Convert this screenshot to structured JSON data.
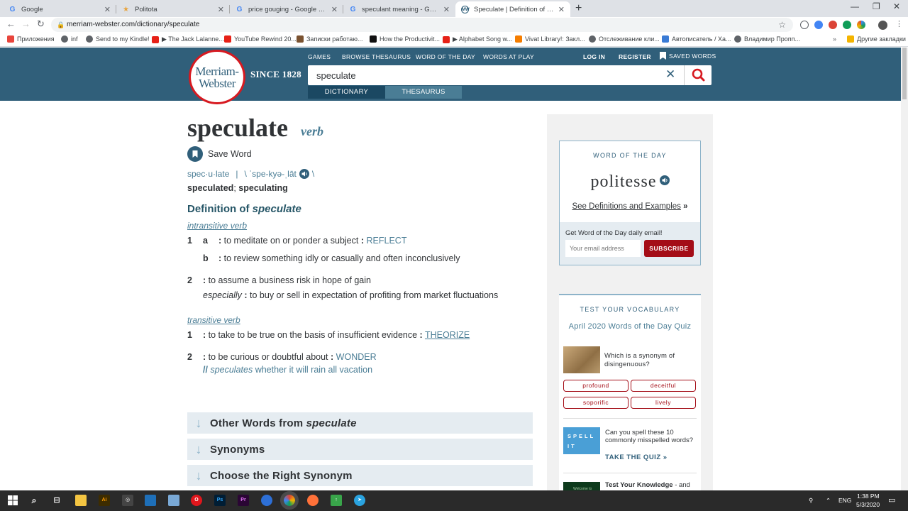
{
  "browser": {
    "tabs": [
      {
        "title": "Google",
        "favicon": "G",
        "color": "#4285f4"
      },
      {
        "title": "Politota",
        "favicon": "★",
        "color": "#e8a33c"
      },
      {
        "title": "price gouging - Google Search",
        "favicon": "G",
        "color": "#4285f4"
      },
      {
        "title": "speculant meaning - Google Sea",
        "favicon": "G",
        "color": "#4285f4"
      },
      {
        "title": "Speculate | Definition of Specula",
        "favicon": "MW",
        "color": "#305f7a"
      }
    ],
    "url": "merriam-webster.com/dictionary/speculate",
    "bookmarks": [
      "Приложения",
      "inf",
      "Send to my Kindle!",
      "▶ The Jack Lalanne...",
      "YouTube Rewind 20...",
      "Записки работаю...",
      "How the Productivit...",
      "▶ Alphabet Song w...",
      "Vivat Library!: Закл...",
      "Отслеживание кли...",
      "Автописатель / Ха...",
      "Владимир Пропп...",
      "Другие закладки"
    ]
  },
  "header": {
    "logo_line1": "Merriam-",
    "logo_line2": "Webster",
    "since": "SINCE 1828",
    "nav": [
      "GAMES",
      "BROWSE THESAURUS",
      "WORD OF THE DAY",
      "WORDS AT PLAY"
    ],
    "login": "LOG IN",
    "register": "REGISTER",
    "saved": "SAVED WORDS",
    "search_value": "speculate",
    "tab_dictionary": "DICTIONARY",
    "tab_thesaurus": "THESAURUS",
    "colors": {
      "header": "#305f7a",
      "tab_active": "#1b4862",
      "tab_inactive": "#4a7d95",
      "accent_red": "#d71920"
    }
  },
  "entry": {
    "headword": "speculate",
    "pos": "verb",
    "save_word": "Save Word",
    "syllables": "spec·u·late",
    "sep": "|",
    "pron_open": "\\ ˈspe-kyə-ˌlāt",
    "pron_close": "\\",
    "form1": "speculated",
    "form_sep": ";",
    "form2": "speculating",
    "def_prefix": "Definition of",
    "def_word": "speculate",
    "intransitive_label": "intransitive verb",
    "transitive_label": "transitive verb",
    "senses": {
      "i1": "1",
      "i1a_letter": "a",
      "i1a_text": "to meditate on or ponder a subject",
      "i1a_link": "REFLECT",
      "i1b_letter": "b",
      "i1b_text": "to review something idly or casually and often inconclusively",
      "i2": "2",
      "i2_text": "to assume a business risk in hope of gain",
      "i2_especially": "especially",
      "i2_sub": "to buy or sell in expectation of profiting from market fluctuations",
      "t1": "1",
      "t1_text": "to take to be true on the basis of insufficient evidence",
      "t1_link": "THEORIZE",
      "t2": "2",
      "t2_text": "to be curious or doubtful about",
      "t2_link": "WONDER",
      "t2_ex_mark": "//",
      "t2_ex_word": "speculates",
      "t2_ex_rest": "whether it will rain all vacation"
    },
    "colon": ":",
    "accordions": [
      {
        "prefix": "Other Words from",
        "italic": "speculate"
      },
      {
        "prefix": "Synonyms",
        "italic": ""
      },
      {
        "prefix": "Choose the Right Synonym",
        "italic": ""
      }
    ]
  },
  "sidebar": {
    "wotd_label": "WORD OF THE DAY",
    "wotd_word": "politesse",
    "wotd_see": "See Definitions and Examples",
    "wotd_chevron": "»",
    "wotd_get": "Get Word of the Day daily email!",
    "wotd_email_placeholder": "Your email address",
    "wotd_subscribe": "SUBSCRIBE",
    "vocab_label": "TEST YOUR VOCABULARY",
    "vocab_quiz": "April 2020 Words of the Day Quiz",
    "vocab_q_prefix": "Which is a synonym of",
    "vocab_q_word": "disingenuous?",
    "options": [
      "profound",
      "deceitful",
      "soporific",
      "lively"
    ],
    "spell_text": "Can you spell these 10 commonly misspelled words?",
    "spell_tile": "SPELL IT",
    "take_quiz": "TAKE THE QUIZ »",
    "tk_bold": "Test Your Knowledge",
    "tk_rest": "- and learn some interesting",
    "tk_tile": "Welcome to"
  },
  "taskbar": {
    "lang": "ENG",
    "time": "1:38 PM",
    "date": "5/3/2020"
  }
}
